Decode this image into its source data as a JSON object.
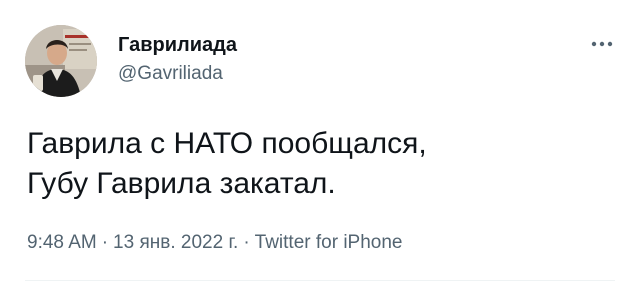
{
  "author": {
    "display_name": "Гаврилиада",
    "handle": "@Gavriliada",
    "avatar_icon": "profile-photo"
  },
  "tweet": {
    "lines": [
      "Гаврила с НАТО пообщался,",
      "Губу Гаврила закатал."
    ],
    "time": "9:48 AM",
    "date": "13 янв. 2022 г.",
    "separator": "·",
    "source": "Twitter for iPhone"
  },
  "icons": {
    "more": "more-horizontal-icon"
  },
  "colors": {
    "text_primary": "#0f1419",
    "text_secondary": "#536471",
    "divider": "#eff3f4"
  }
}
